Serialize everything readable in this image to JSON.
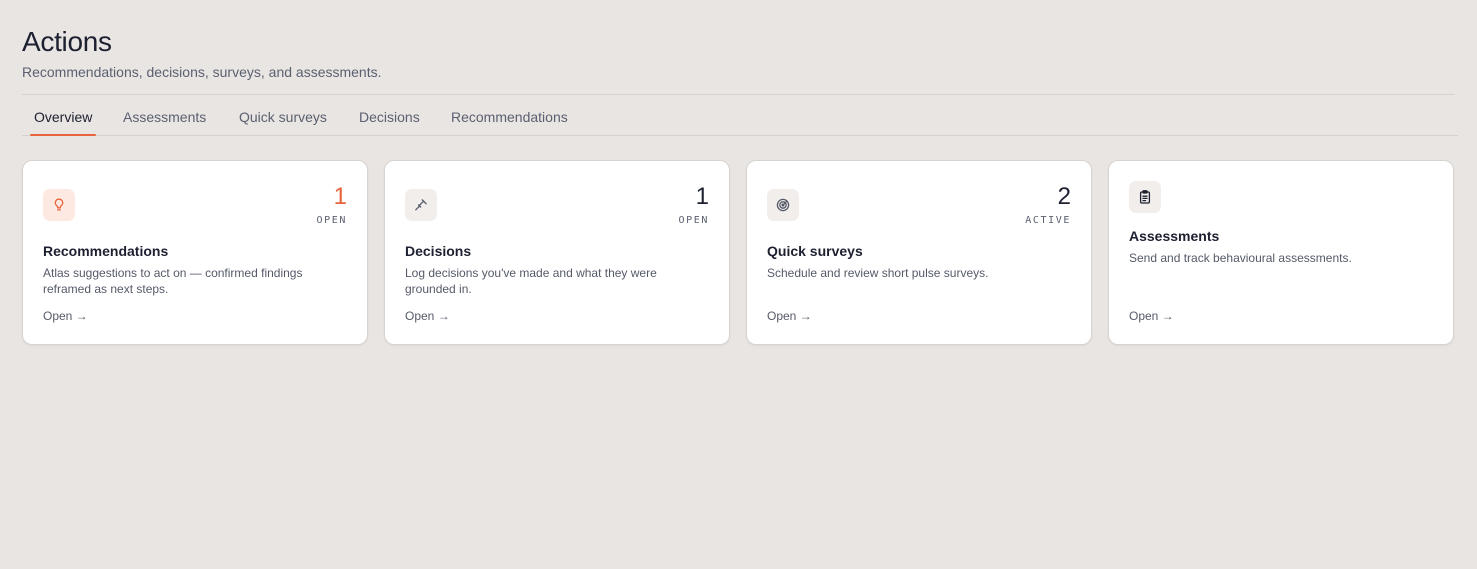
{
  "header": {
    "title": "Actions",
    "subtitle": "Recommendations, decisions, surveys, and assessments."
  },
  "tabs": [
    {
      "label": "Overview",
      "active": true
    },
    {
      "label": "Assessments",
      "active": false
    },
    {
      "label": "Quick surveys",
      "active": false
    },
    {
      "label": "Decisions",
      "active": false
    },
    {
      "label": "Recommendations",
      "active": false
    }
  ],
  "cards": [
    {
      "icon": "lightbulb-icon",
      "count": "1",
      "count_label": "OPEN",
      "title": "Recommendations",
      "description": "Atlas suggestions to act on — confirmed findings reframed as next steps.",
      "link": "Open →"
    },
    {
      "icon": "gavel-icon",
      "count": "1",
      "count_label": "OPEN",
      "title": "Decisions",
      "description": "Log decisions you've made and what they were grounded in.",
      "link": "Open →"
    },
    {
      "icon": "radar-icon",
      "count": "2",
      "count_label": "ACTIVE",
      "title": "Quick surveys",
      "description": "Schedule and review short pulse surveys.",
      "link": "Open →"
    },
    {
      "icon": "clipboard-icon",
      "title": "Assessments",
      "description": "Send and track behavioural assessments.",
      "link": "Open →"
    }
  ],
  "colors": {
    "accent": "#e8643c",
    "background": "#e9e5e2",
    "card": "#ffffff"
  }
}
